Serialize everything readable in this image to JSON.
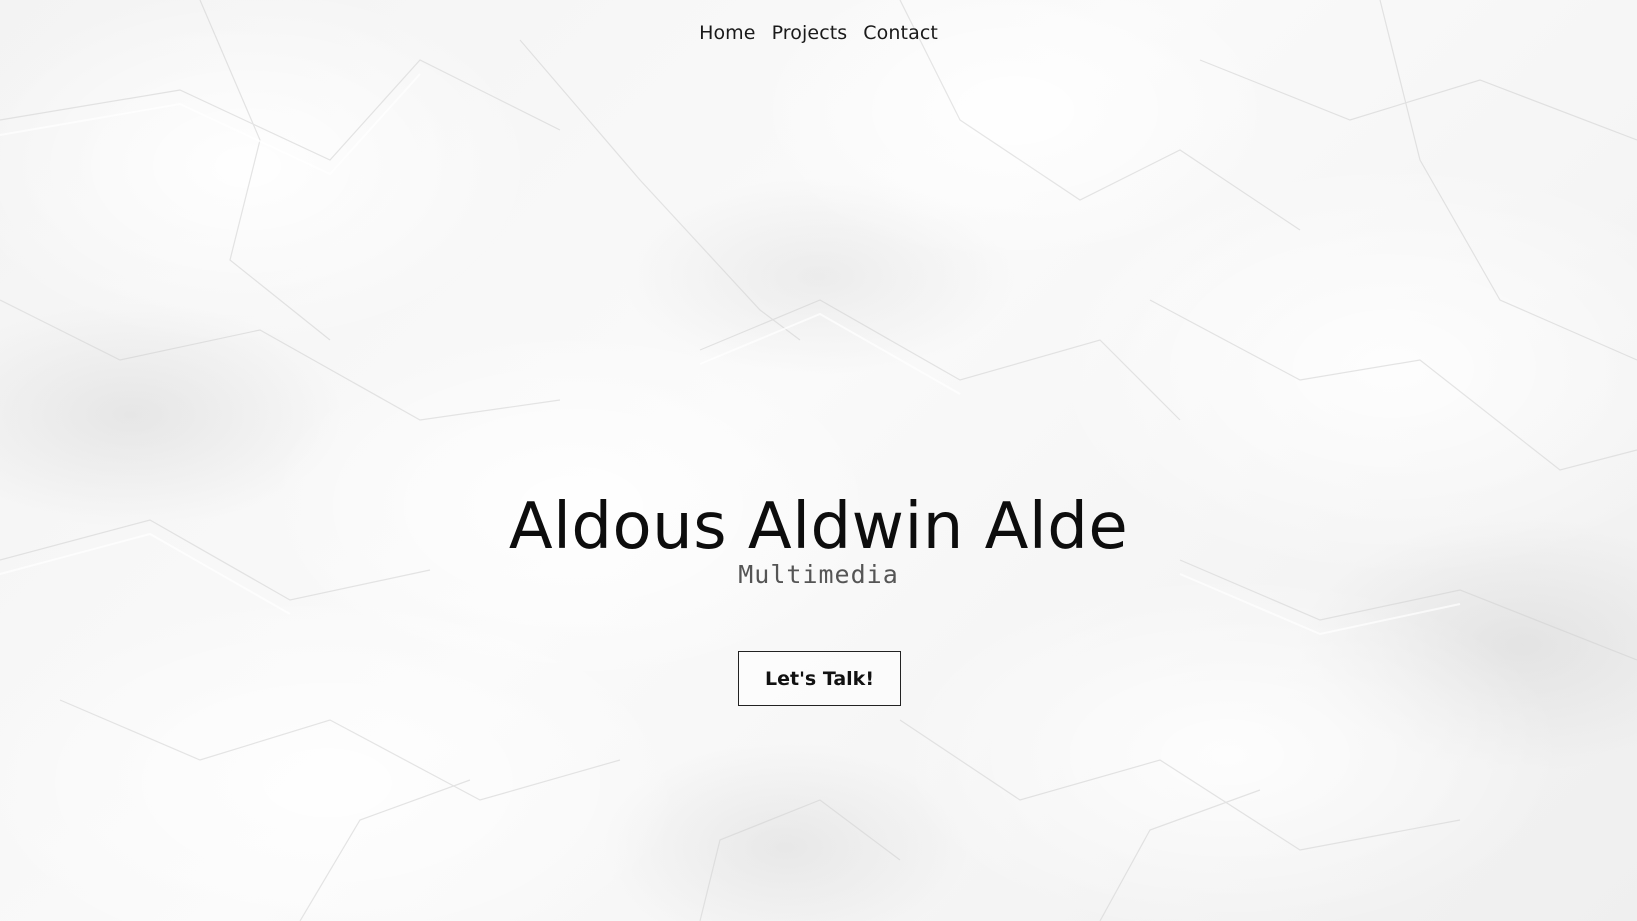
{
  "nav": {
    "items": [
      {
        "label": "Home"
      },
      {
        "label": "Projects"
      },
      {
        "label": "Contact"
      }
    ]
  },
  "hero": {
    "title": "Aldous Aldwin Alde",
    "subtitle": "Multimedia",
    "cta_label": "Let's Talk!"
  },
  "colors": {
    "background": "#f5f5f5",
    "text": "#111111",
    "subtitle": "#555555"
  }
}
